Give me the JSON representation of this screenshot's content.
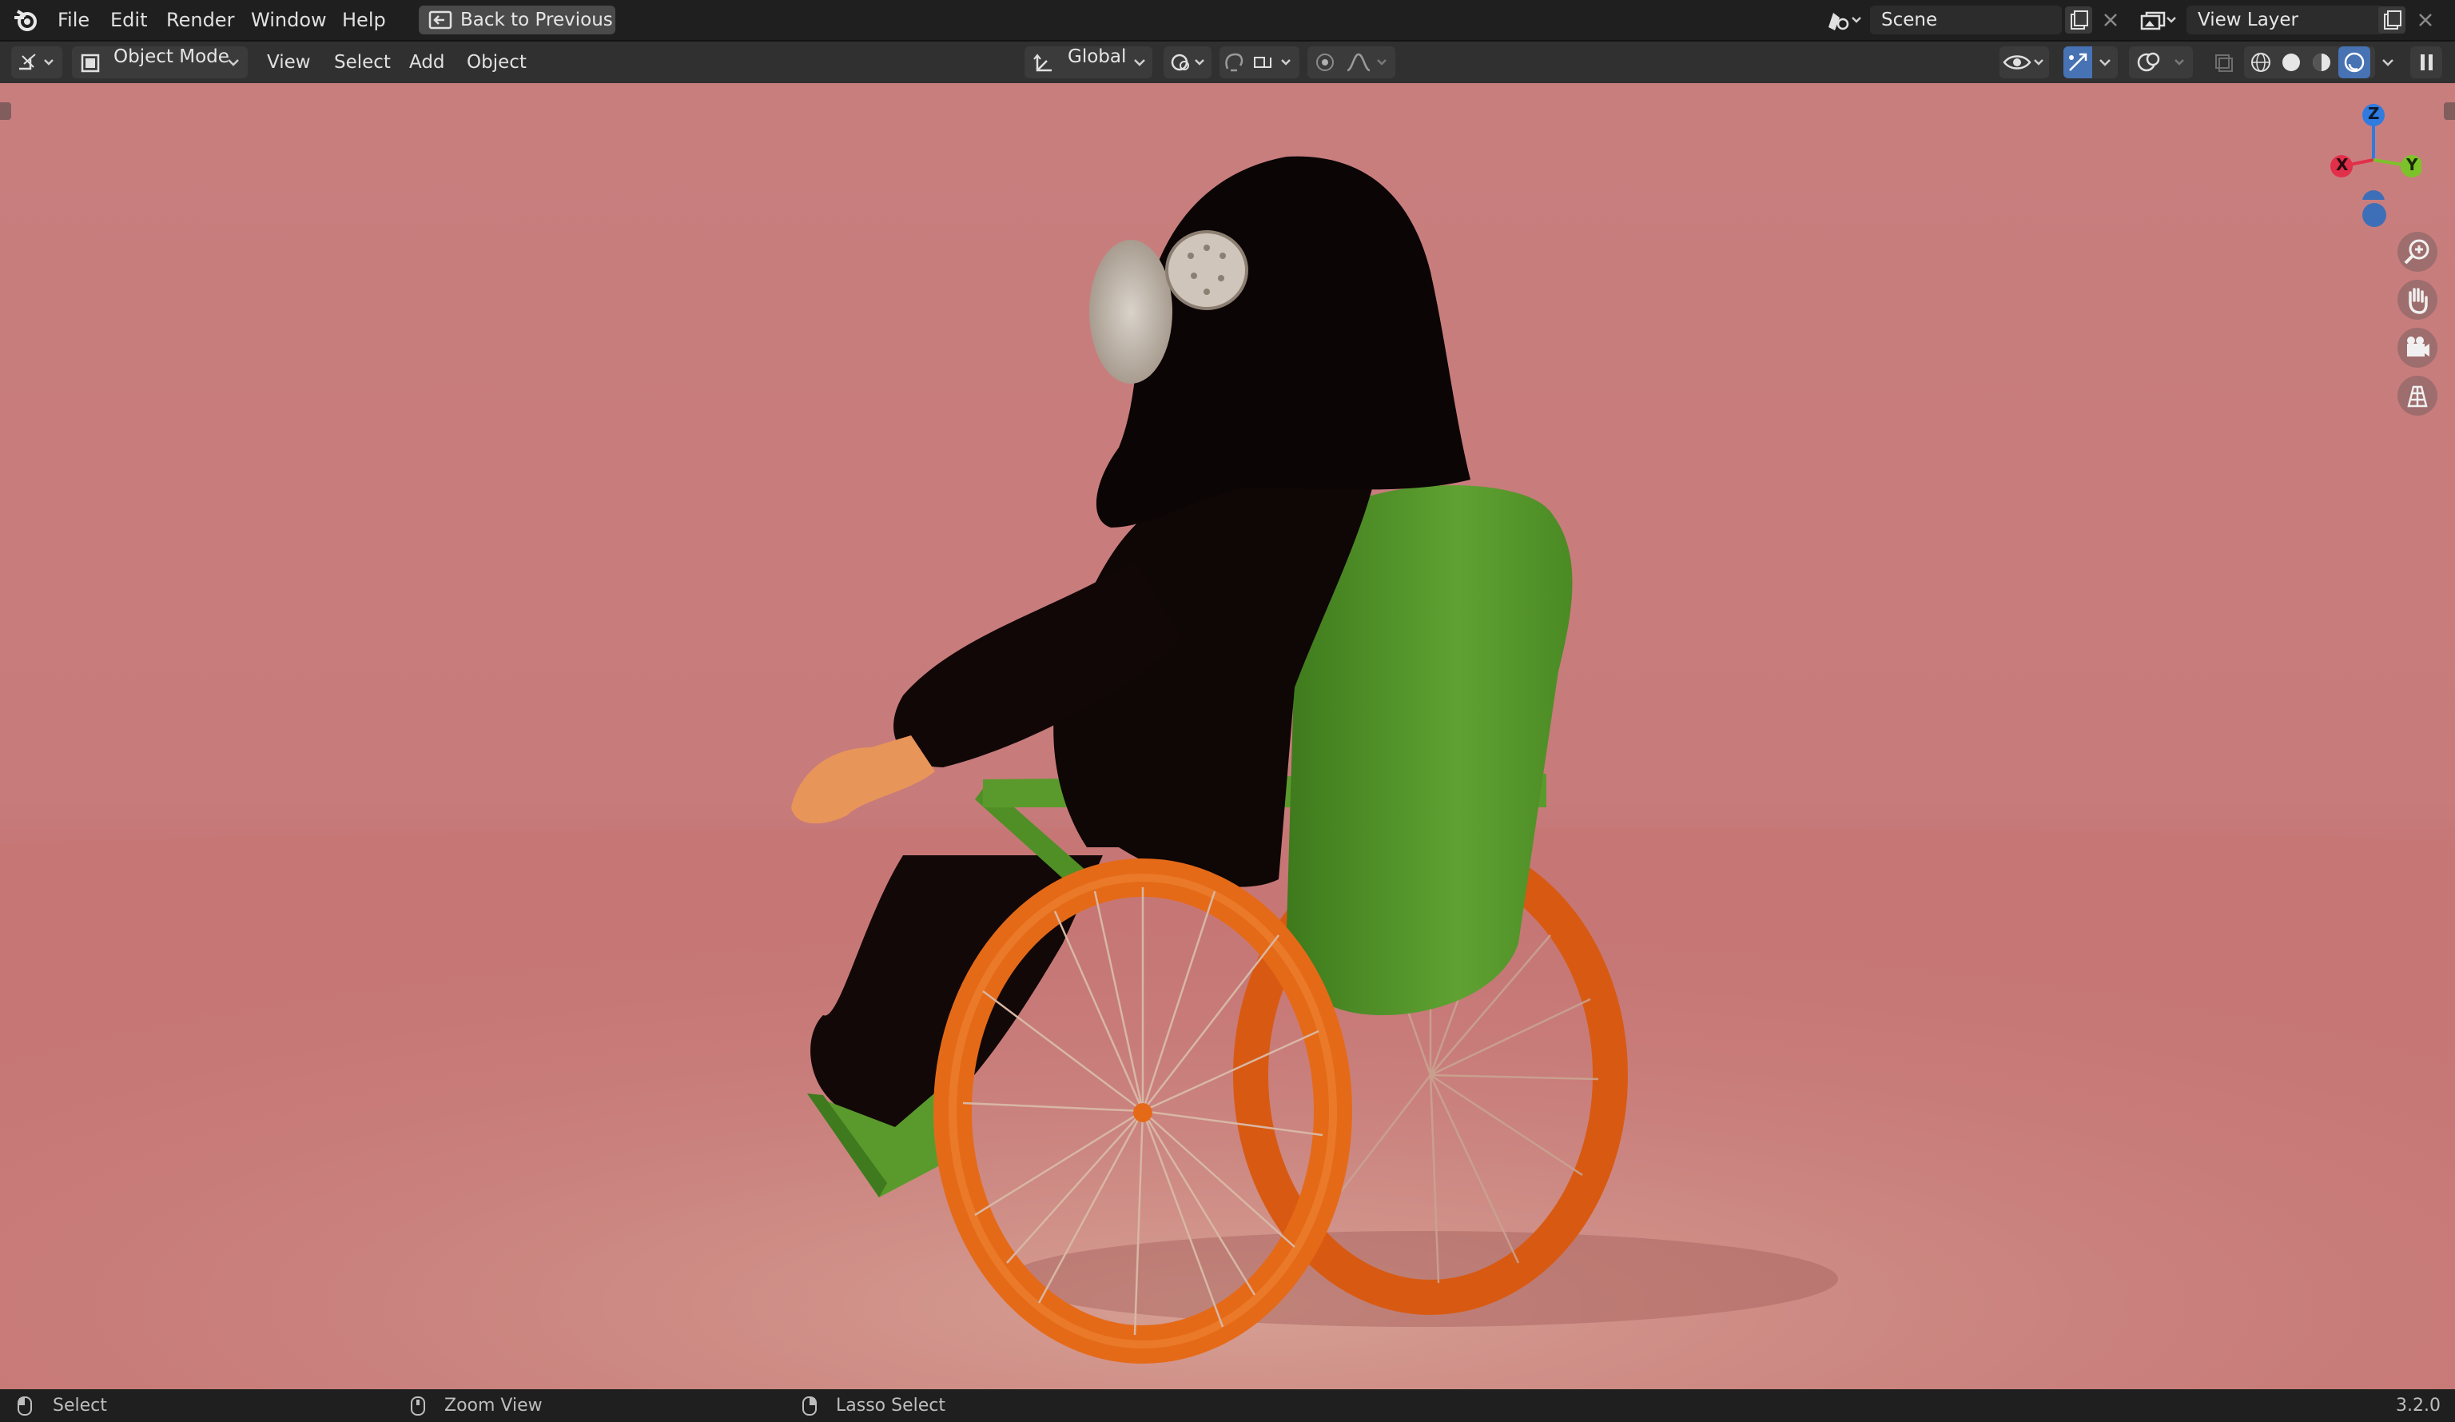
{
  "topbar": {
    "menu": [
      "File",
      "Edit",
      "Render",
      "Window",
      "Help"
    ],
    "back_button": "Back to Previous",
    "scene": "Scene",
    "view_layer": "View Layer"
  },
  "header": {
    "mode": "Object Mode",
    "menus": [
      "View",
      "Select",
      "Add",
      "Object"
    ],
    "transform_orientation": "Global"
  },
  "gizmo": {
    "axes": [
      "Z",
      "X",
      "Y"
    ]
  },
  "viewport": {
    "background": "#c97e7e",
    "floor_color": "#c98a82",
    "objects": [
      "hooded-figure",
      "wheelchair"
    ],
    "colors": {
      "robe": "#0f0606",
      "chair_green": "#5a9a2c",
      "wheel_orange": "#e56a18",
      "mask": "#d8d0c8"
    }
  },
  "status": {
    "left_action": "Select",
    "middle_action": "Zoom View",
    "right_action": "Lasso Select",
    "version": "3.2.0"
  },
  "icons": [
    "blender-logo-icon",
    "editor-type-icon",
    "object-mode-icon",
    "transform-orientation-icon",
    "pivot-icon",
    "snap-icon",
    "proportional-icon",
    "visibility-icon",
    "gizmo-icon",
    "overlay-icon",
    "xray-icon",
    "wireframe-icon",
    "solid-icon",
    "material-icon",
    "rendered-icon",
    "zoom-icon",
    "hand-icon",
    "camera-icon",
    "grid-icon"
  ]
}
